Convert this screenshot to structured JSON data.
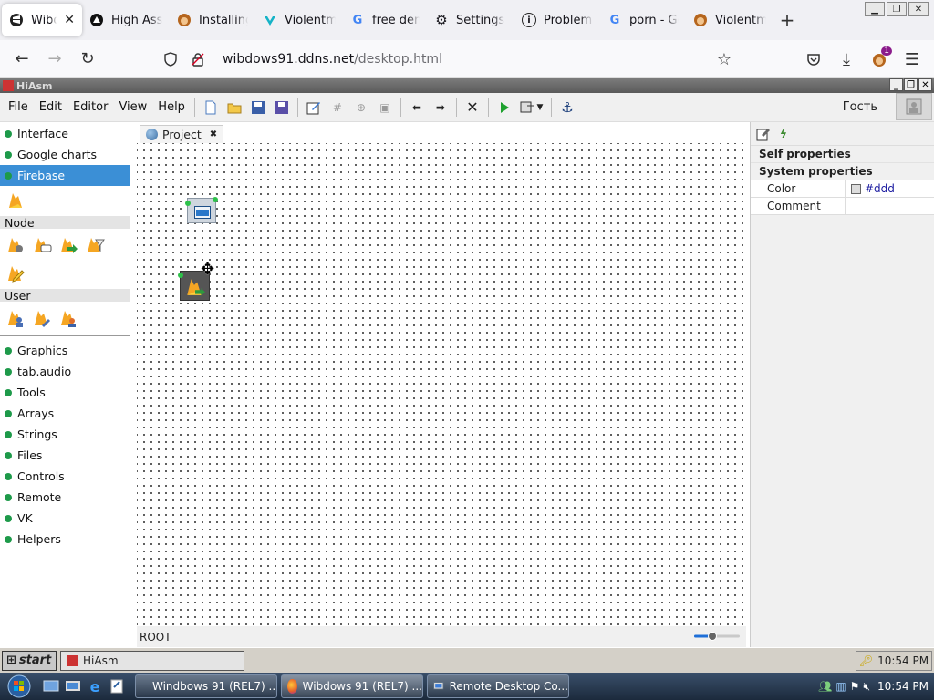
{
  "browser": {
    "tabs": [
      {
        "label": "Wibdows",
        "favicon": "windows-logo-icon",
        "active": true
      },
      {
        "label": "High Asse",
        "favicon": "wolf-icon"
      },
      {
        "label": "Installing",
        "favicon": "tampermonkey-icon"
      },
      {
        "label": "Violentm",
        "favicon": "violentmonkey-icon"
      },
      {
        "label": "free demo",
        "favicon": "google-icon"
      },
      {
        "label": "Settings",
        "favicon": "gear-icon"
      },
      {
        "label": "Problem l",
        "favicon": "info-icon"
      },
      {
        "label": "porn - Go",
        "favicon": "google-icon"
      },
      {
        "label": "Violentm",
        "favicon": "tampermonkey-icon"
      }
    ],
    "url_host": "wibdows91.ddns.net",
    "url_path": "/desktop.html",
    "extension_badge": "1"
  },
  "app": {
    "title": "HiAsm",
    "menu": [
      "File",
      "Edit",
      "Editor",
      "View",
      "Help"
    ],
    "user": "Гость"
  },
  "palette": {
    "top_items": [
      "Interface",
      "Google charts",
      "Firebase"
    ],
    "selected": "Firebase",
    "groups": [
      {
        "label": "Node"
      },
      {
        "label": "User"
      }
    ],
    "bottom_items": [
      "Graphics",
      "tab.audio",
      "Tools",
      "Arrays",
      "Strings",
      "Files",
      "Controls",
      "Remote",
      "VK",
      "Helpers"
    ]
  },
  "project": {
    "tab_label": "Project",
    "status": "ROOT",
    "zoom_level": 0.4
  },
  "properties": {
    "headers": [
      "Self properties",
      "System properties"
    ],
    "rows": [
      {
        "key": "Color",
        "value": "#ddd"
      },
      {
        "key": "Comment",
        "value": ""
      }
    ]
  },
  "w91taskbar": {
    "start": "start",
    "task": "HiAsm",
    "clock": "10:54 PM"
  },
  "w7taskbar": {
    "tasks": [
      "Windbows 91 (REL7) ...",
      "Wibdows 91 (REL7) ...",
      "Remote Desktop Co..."
    ],
    "clock": "10:54 PM"
  },
  "colors": {
    "selected": "#3b8fd6",
    "dot": "#1e9a4a",
    "firebase": "#f5a623"
  }
}
